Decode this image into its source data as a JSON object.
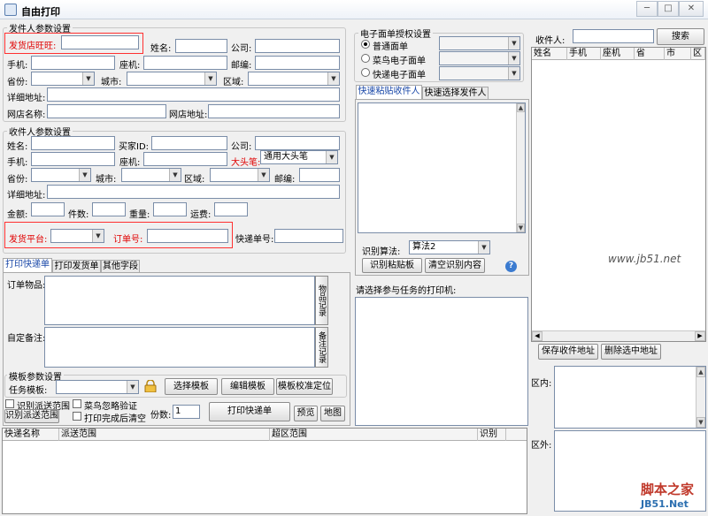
{
  "window": {
    "title": "自由打印",
    "minimize": "─",
    "restore": "□",
    "close": "✕"
  },
  "sender": {
    "group_title": "发件人参数设置",
    "wangwang_label": "发货店旺旺:",
    "name_label": "姓名:",
    "company_label": "公司:",
    "mobile_label": "手机:",
    "phone_label": "座机:",
    "zip_label": "邮编:",
    "province_label": "省份:",
    "city_label": "城市:",
    "district_label": "区域:",
    "address_label": "详细地址:",
    "shop_name_label": "网店名称:",
    "shop_url_label": "网店地址:"
  },
  "receiver": {
    "group_title": "收件人参数设置",
    "name_label": "姓名:",
    "buyer_id_label": "买家ID:",
    "company_label": "公司:",
    "mobile_label": "手机:",
    "phone_label": "座机:",
    "bighead_label": "大头笔:",
    "bighead_value": "通用大头笔",
    "province_label": "省份:",
    "city_label": "城市:",
    "district_label": "区域:",
    "zip_label": "邮编:",
    "address_label": "详细地址:",
    "amount_label": "金额:",
    "pieces_label": "件数:",
    "weight_label": "重量:",
    "freight_label": "运费:",
    "platform_label": "发货平台:",
    "order_no_label": "订单号:",
    "express_no_label": "快递单号:"
  },
  "tabs_print": [
    "打印快递单",
    "打印发货单",
    "其他字段"
  ],
  "order_items_label": "订单物品:",
  "item_record_button": "物品记录",
  "remark_label": "自定备注:",
  "remark_record_button": "备注记录",
  "template": {
    "group_title": "模板参数设置",
    "task_template_label": "任务模板:",
    "select_button": "选择模板",
    "edit_button": "编辑模板",
    "calibrate_button": "模板校准定位"
  },
  "options": {
    "identify_range_check": "识别派送范围",
    "cainiao_check": "菜鸟忽略验证",
    "identify_range_button": "识别派送范围",
    "clear_after_print_check": "打印完成后清空",
    "copies_label": "份数:",
    "copies_value": "1",
    "print_button": "打印快递单",
    "preview_button": "预览",
    "map_button": "地图"
  },
  "bottom_table": {
    "headers": [
      "快递名称",
      "派送范围",
      "超区范围",
      "识别"
    ]
  },
  "eface": {
    "group_title": "电子面单授权设置",
    "options": [
      "普通面单",
      "菜鸟电子面单",
      "快递电子面单"
    ],
    "selected": 0
  },
  "paste_tabs": [
    "快速粘贴收件人",
    "快速选择发件人"
  ],
  "identify": {
    "algo_label": "识别算法:",
    "algo_value": "算法2",
    "paste_button": "识别粘贴板",
    "clear_button": "清空识别内容",
    "help_icon": "?"
  },
  "printer_label": "请选择参与任务的打印机:",
  "search": {
    "receiver_label": "收件人:",
    "search_button": "搜索"
  },
  "receiver_table": {
    "headers": [
      "姓名",
      "手机",
      "座机",
      "省",
      "市",
      "区"
    ]
  },
  "save_receiver_button": "保存收件地址",
  "delete_selected_button": "删除选中地址",
  "inside_label": "区内:",
  "outside_label": "区外:",
  "watermark_site": "www.jb51.net",
  "watermark_logo": "脚本之家",
  "watermark_logo_url": "JB51.Net",
  "colors": {
    "accent": "#1a48a8",
    "highlight": "#e00000"
  }
}
